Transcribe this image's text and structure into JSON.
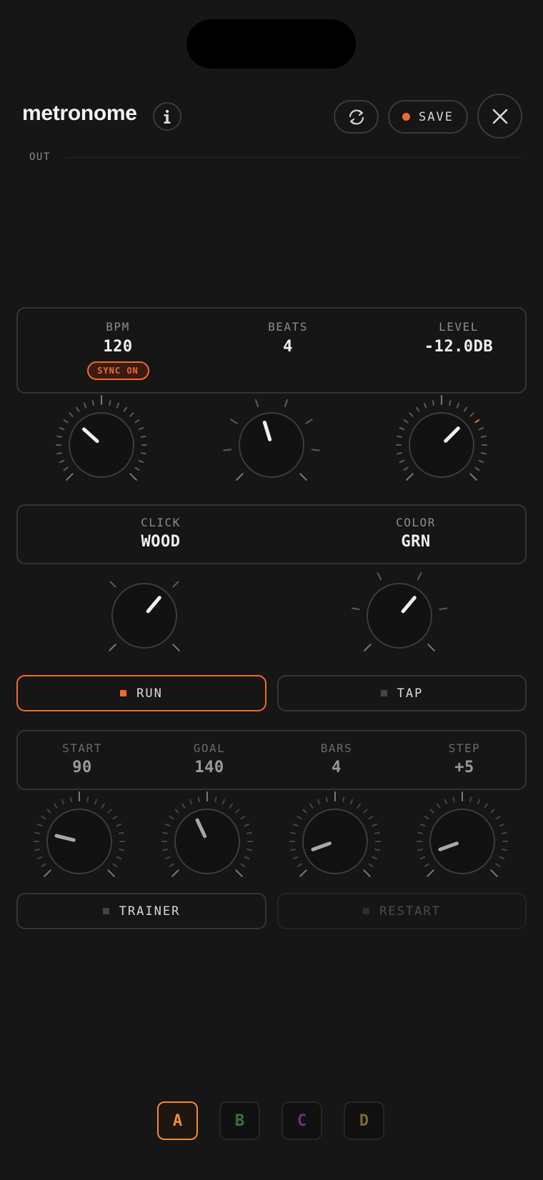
{
  "header": {
    "title": "metronome",
    "info_icon": "info-icon",
    "sync_icon": "sync-icon",
    "save_label": "SAVE",
    "close_icon": "close-icon"
  },
  "output": {
    "label": "OUT"
  },
  "main_panel": {
    "params": [
      {
        "label": "BPM",
        "value": "120",
        "badge": "SYNC ON"
      },
      {
        "label": "BEATS",
        "value": "4"
      },
      {
        "label": "LEVEL",
        "value": "-12.0DB"
      }
    ]
  },
  "sound_panel": {
    "params": [
      {
        "label": "CLICK",
        "value": "WOOD"
      },
      {
        "label": "COLOR",
        "value": "GRN"
      }
    ]
  },
  "transport": {
    "run_label": "RUN",
    "tap_label": "TAP",
    "run_active": true
  },
  "trainer_panel": {
    "params": [
      {
        "label": "START",
        "value": "90"
      },
      {
        "label": "GOAL",
        "value": "140"
      },
      {
        "label": "BARS",
        "value": "4"
      },
      {
        "label": "STEP",
        "value": "+5"
      }
    ]
  },
  "trainer_controls": {
    "trainer_label": "TRAINER",
    "restart_label": "RESTART",
    "restart_enabled": false
  },
  "banks": [
    {
      "label": "A",
      "color": "#f08a3a",
      "active": true
    },
    {
      "label": "B",
      "color": "#2f7a3a",
      "active": false
    },
    {
      "label": "C",
      "color": "#6a2f8a",
      "active": false
    },
    {
      "label": "D",
      "color": "#7a6a2a",
      "active": false
    }
  ],
  "colors": {
    "accent": "#f26a2e",
    "background": "#161616"
  }
}
